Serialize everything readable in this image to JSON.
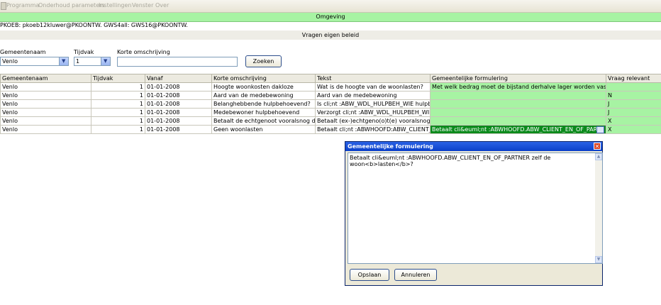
{
  "menu": [
    "Programma",
    "Onderhoud parameters",
    "Instellingen",
    "Venster",
    "Over"
  ],
  "environment_title": "Omgeving",
  "connection": "PKOEB: pkoeb12kluwer@PKOONTW. GWS4all: GWS16@PKOONTW.",
  "section_title": "Vragen eigen beleid",
  "filters": {
    "gemeente_label": "Gemeentenaam",
    "gemeente_value": "Venlo",
    "tijdvak_label": "Tijdvak",
    "tijdvak_value": "1",
    "omschrijving_label": "Korte omschrijving",
    "omschrijving_value": "",
    "zoeken_label": "Zoeken"
  },
  "table": {
    "headers": [
      "Gemeentenaam",
      "Tijdvak",
      "Vanaf",
      "Korte omschrijving",
      "Tekst",
      "Gemeentelijke formulering",
      "Vraag relevant"
    ],
    "rows": [
      [
        "Venlo",
        "1",
        "01-01-2008",
        "Hoogte woonkosten dakloze",
        "Wat is de hoogte van de woonlasten?",
        "Met welk bedrag moet de bijstand derhalve lager worden vastgesteld?<br><",
        ""
      ],
      [
        "Venlo",
        "1",
        "01-01-2008",
        "Aard van de medebewoning",
        "Aard van de medebewoning",
        "",
        "N"
      ],
      [
        "Venlo",
        "1",
        "01-01-2008",
        "Belanghebbende hulpbehoevend?",
        "Is cli;nt :ABW_WDL_HULPBEH_WIE hulpbehoev",
        "",
        "J"
      ],
      [
        "Venlo",
        "1",
        "01-01-2008",
        "Medebewoner hulpbehoevend",
        "Verzorgt cli;nt :ABW_WDL_HULPBEH_WIE  :AB",
        "",
        "J"
      ],
      [
        "Venlo",
        "1",
        "01-01-2008",
        "Betaalt de echtgenoot vooralsnog de woonk",
        "Betaalt (ex-)echtgeno(o)t(e) vooralsnog de woonk",
        "",
        "X"
      ],
      [
        "Venlo",
        "1",
        "01-01-2008",
        "Geen woonlasten",
        "Betaalt cli;nt :ABWHOOFD:ABW_CLIENT_EN_O",
        "Betaalt cli&euml;nt :ABWHOOFD.ABW_CLIENT_EN_OF_PARTNER ze",
        "X"
      ]
    ]
  },
  "dialog": {
    "title": "Gemeentelijke formulering",
    "text": "Betaalt cli&euml;nt :ABWHOOFD.ABW_CLIENT_EN_OF_PARTNER zelf de woon<b>lasten</b>?",
    "ok_label": "Opslaan",
    "cancel_label": "Annuleren"
  },
  "colors": {
    "accent_green": "#a7f3a3",
    "selected_green": "#0b8a1c",
    "dialog_title": "#0a3fc9"
  }
}
